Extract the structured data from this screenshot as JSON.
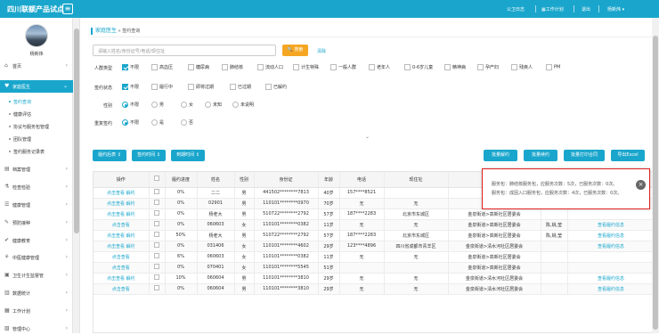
{
  "app": {
    "title": "四川联额产品试点",
    "menu_icon": "menu-icon"
  },
  "topnav": {
    "items": [
      "公卫日志",
      "工作计划",
      "退出",
      "杨新炜 ▾"
    ]
  },
  "user": {
    "name": "杨新炜"
  },
  "sidebar": {
    "items": [
      {
        "label": "首页",
        "icon": "home-icon",
        "glyph": "⌂"
      },
      {
        "label": "家庭医生",
        "icon": "family-doctor-icon",
        "glyph": "♥"
      },
      {
        "label": "档案管理",
        "icon": "archive-icon",
        "glyph": "▤"
      },
      {
        "label": "检查检验",
        "icon": "lab-icon",
        "glyph": "⚗"
      },
      {
        "label": "健康管理",
        "icon": "health-icon",
        "glyph": "☰"
      },
      {
        "label": "预防接种",
        "icon": "vaccine-icon",
        "glyph": "✎"
      },
      {
        "label": "健康教育",
        "icon": "education-icon",
        "glyph": "✔"
      },
      {
        "label": "中医健康管理",
        "icon": "tcm-icon",
        "glyph": "⚘"
      },
      {
        "label": "卫生计生监督管",
        "icon": "supervision-icon",
        "glyph": "▣"
      },
      {
        "label": "数据统计",
        "icon": "stats-icon",
        "glyph": "▥"
      },
      {
        "label": "工作计划",
        "icon": "plan-icon",
        "glyph": "▦"
      },
      {
        "label": "管理中心",
        "icon": "admin-icon",
        "glyph": "▧"
      }
    ],
    "subitems": [
      "签约查询",
      "健康评估",
      "协议与服务包管理",
      "团队管理",
      "签约服务记录表"
    ]
  },
  "breadcrumb": {
    "title": "家庭医生",
    "sep": " » ",
    "current": "签约查询"
  },
  "search": {
    "placeholder": "请输入姓名/身份证号/电话/现住址",
    "button": "🔍 搜索",
    "clear": "清除"
  },
  "filters": {
    "population": {
      "label": "人群类型",
      "options": [
        {
          "t": "不限",
          "on": true
        },
        {
          "t": "高血压",
          "on": false
        },
        {
          "t": "糖尿病",
          "on": false
        },
        {
          "t": "肺结核",
          "on": false
        },
        {
          "t": "流动人口",
          "on": false
        },
        {
          "t": "计生特殊",
          "on": false
        },
        {
          "t": "一般人群",
          "on": false
        },
        {
          "t": "老年人",
          "on": false
        },
        {
          "t": "0-6岁儿童",
          "on": false
        },
        {
          "t": "精神病",
          "on": false
        },
        {
          "t": "孕产妇",
          "on": false
        },
        {
          "t": "残疾人",
          "on": false
        },
        {
          "t": "PM",
          "on": false
        }
      ]
    },
    "sign_status": {
      "label": "签约状态",
      "options": [
        {
          "t": "不限",
          "on": true
        },
        {
          "t": "履行中",
          "on": false
        },
        {
          "t": "即将过期",
          "on": false
        },
        {
          "t": "已过期",
          "on": false
        },
        {
          "t": "已解约",
          "on": false
        }
      ]
    },
    "gender": {
      "label": "性别",
      "options": [
        {
          "t": "不限",
          "on": true
        },
        {
          "t": "男",
          "on": false
        },
        {
          "t": "女",
          "on": false
        },
        {
          "t": "未知",
          "on": false
        },
        {
          "t": "未说明",
          "on": false
        }
      ]
    },
    "resign": {
      "label": "重复签约",
      "options": [
        {
          "t": "不限",
          "on": true
        },
        {
          "t": "是",
          "on": false
        },
        {
          "t": "否",
          "on": false
        }
      ]
    }
  },
  "actions": {
    "left": [
      "履约后表 ↕",
      "签约时间 ↕",
      "到期时间 ↕"
    ],
    "right": [
      "批量解约",
      "批量续约",
      "批量打印合同",
      "导出Excel"
    ]
  },
  "table": {
    "headers": [
      "操作",
      "",
      "履约进度",
      "姓名",
      "性别",
      "身份证",
      "年龄",
      "电话",
      "现住址",
      "区县",
      "",
      "履约信息"
    ],
    "rows": [
      [
        "点击查看 解约",
        "",
        "0%",
        "二二",
        "男",
        "441502********7813",
        "40岁",
        "157****8521",
        "",
        "",
        "",
        ""
      ],
      [
        "点击查看 解约",
        "",
        "0%",
        "02901",
        "男",
        "110101********0970",
        "70岁",
        "无",
        "无",
        "",
        "",
        "查看履约信息"
      ],
      [
        "点击查看 解约",
        "",
        "0%",
        "杨老大",
        "男",
        "510722********2792",
        "57岁",
        "187****2283",
        "北京市东城区",
        "金泉街道>高新社区居委会",
        "",
        ""
      ],
      [
        "点击查看",
        "",
        "0%",
        "060603",
        "女",
        "110101********0382",
        "11岁",
        "无",
        "无",
        "金泉街道>高新社区居委会",
        "陈,姚,莹",
        "查看履约信息"
      ],
      [
        "点击查看 解约",
        "",
        "50%",
        "杨老大",
        "男",
        "510722********2792",
        "57岁",
        "187****2283",
        "北京市东城区",
        "金泉街道>高新社区居委会",
        "陈,姚,莹",
        "查看履约信息"
      ],
      [
        "点击查看 解约",
        "",
        "0%",
        "031406",
        "女",
        "110101********4602",
        "29岁",
        "123****4896",
        "四川省成都市青羊区",
        "金泉街道>清水河社区居委会",
        "",
        "查看履约信息"
      ],
      [
        "点击查看",
        "",
        "6%",
        "060603",
        "女",
        "110101********0382",
        "11岁",
        "无",
        "无",
        "金泉街道>高新社区居委会",
        "",
        ""
      ],
      [
        "点击查看",
        "",
        "0%",
        "070401",
        "女",
        "110101********5545",
        "51岁",
        "",
        "",
        "金泉街道>高新社区居委会",
        "",
        ""
      ],
      [
        "点击查看 解约",
        "",
        "10%",
        "060604",
        "男",
        "110101********3810",
        "29岁",
        "无",
        "无",
        "金泉街道>清水河社区居委会",
        "",
        "查看履约信息"
      ],
      [
        "点击查看",
        "",
        "0%",
        "060604",
        "男",
        "110101********3810",
        "29岁",
        "无",
        "无",
        "金泉街道>清水河社区居委会",
        "",
        "查看履约信息"
      ]
    ]
  },
  "popup": {
    "line1": "服务包：肺结核服务包，应服务次数：5次，已服务次数：0次。",
    "line2": "服务包：成因入口服务包，应服务次数：4次，已服务次数：0次。",
    "close": "×"
  },
  "collapse": "⌄",
  "colors": {
    "accent": "#1aa6cc",
    "orange": "#f5a623",
    "alert": "#e02020"
  }
}
